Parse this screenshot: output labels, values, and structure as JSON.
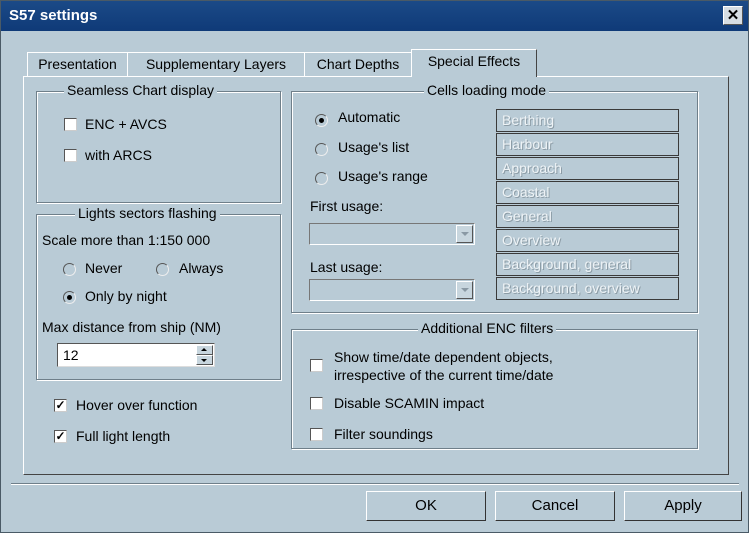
{
  "window": {
    "title": "S57 settings",
    "close_label": "✕"
  },
  "tabs": [
    {
      "label": "Presentation"
    },
    {
      "label": "Supplementary Layers"
    },
    {
      "label": "Chart Depths"
    },
    {
      "label": "Special Effects",
      "active": true
    }
  ],
  "seamless": {
    "title": "Seamless Chart display",
    "enc_avcs": {
      "label": "ENC + AVCS",
      "checked": false
    },
    "arcs": {
      "label": "with ARCS",
      "checked": false
    }
  },
  "lights": {
    "title": "Lights sectors flashing",
    "scale_label": "Scale more than 1:150 000",
    "options": [
      {
        "label": "Never",
        "selected": false
      },
      {
        "label": "Always",
        "selected": false
      },
      {
        "label": "Only by night",
        "selected": true
      }
    ],
    "max_distance_label": "Max distance from ship (NM)",
    "max_distance_value": "12"
  },
  "hover_function": {
    "label": "Hover over function",
    "checked": true
  },
  "full_light_length": {
    "label": "Full light length",
    "checked": true
  },
  "cells": {
    "title": "Cells loading mode",
    "modes": [
      {
        "label": "Automatic",
        "selected": true
      },
      {
        "label": "Usage's list",
        "selected": false
      },
      {
        "label": "Usage's range",
        "selected": false
      }
    ],
    "first_usage_label": "First usage:",
    "last_usage_label": "Last usage:",
    "usages": [
      "Berthing",
      "Harbour",
      "Approach",
      "Coastal",
      "General",
      "Overview",
      "Background, general",
      "Background, overview"
    ]
  },
  "filters": {
    "title": "Additional ENC filters",
    "time_line1": "Show time/date dependent objects,",
    "time_line2": "irrespective of the current time/date",
    "scamin": "Disable SCAMIN impact",
    "soundings": "Filter soundings"
  },
  "buttons": {
    "ok": "OK",
    "cancel": "Cancel",
    "apply": "Apply"
  }
}
